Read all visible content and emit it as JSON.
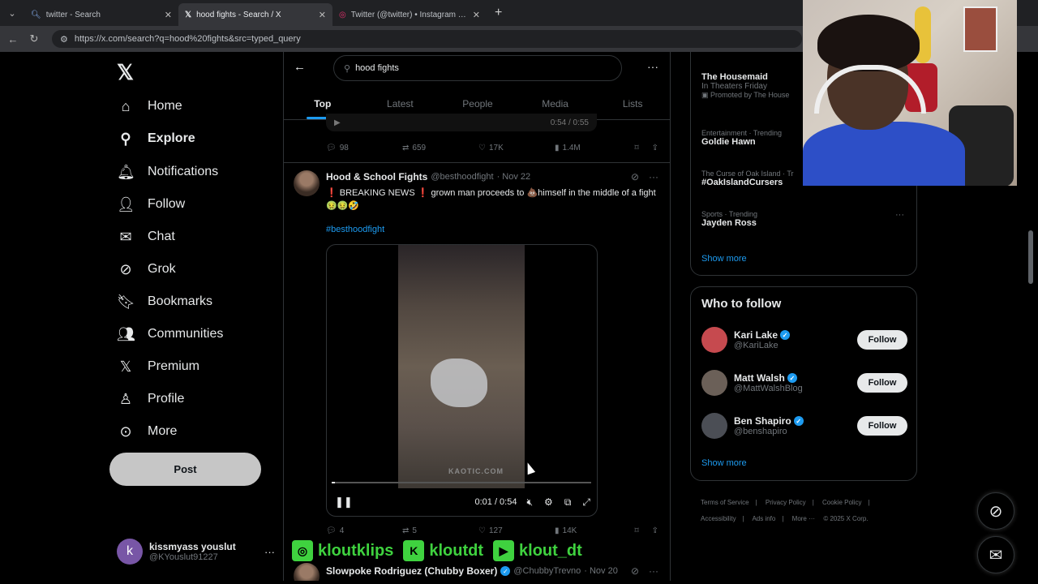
{
  "browser": {
    "tabs": [
      {
        "title": "twitter - Search",
        "icon": "search-icon"
      },
      {
        "title": "hood fights - Search / X",
        "icon": "x-logo-icon"
      },
      {
        "title": "Twitter (@twitter) • Instagram phot",
        "icon": "instagram-icon"
      }
    ],
    "url": "https://x.com/search?q=hood%20fights&src=typed_query"
  },
  "nav": {
    "items": [
      {
        "label": "Home",
        "icon": "home-icon"
      },
      {
        "label": "Explore",
        "icon": "search-icon"
      },
      {
        "label": "Notifications",
        "icon": "bell-icon"
      },
      {
        "label": "Follow",
        "icon": "follow-icon"
      },
      {
        "label": "Chat",
        "icon": "mail-icon"
      },
      {
        "label": "Grok",
        "icon": "grok-icon"
      },
      {
        "label": "Bookmarks",
        "icon": "bookmark-icon"
      },
      {
        "label": "Communities",
        "icon": "communities-icon"
      },
      {
        "label": "Premium",
        "icon": "x-logo-icon"
      },
      {
        "label": "Profile",
        "icon": "profile-icon"
      },
      {
        "label": "More",
        "icon": "more-icon"
      }
    ],
    "post_label": "Post"
  },
  "account": {
    "initial": "k",
    "name": "kissmyass youslut",
    "handle": "@KYouslut91227"
  },
  "search": {
    "query": "hood fights",
    "tabs": [
      "Top",
      "Latest",
      "People",
      "Media",
      "Lists"
    ]
  },
  "prev_tweet": {
    "video_time": "0:54 / 0:55",
    "replies": "98",
    "reposts": "659",
    "likes": "17K",
    "views": "1.4M"
  },
  "tweet": {
    "name": "Hood & School Fights",
    "handle": "@besthoodfight",
    "date": "· Nov 22",
    "text": "❗ BREAKING NEWS ❗ grown man proceeds to 💩himself in the middle of a fight🤢🤢🤣",
    "hashtag": "#besthoodfight",
    "video_time": "0:01 / 0:54",
    "watermark": "KAOTIC.COM",
    "replies": "4",
    "reposts": "5",
    "likes": "127",
    "views": "14K"
  },
  "next_tweet": {
    "name": "Slowpoke Rodriguez (Chubby Boxer)",
    "handle": "@ChubbyTrevno",
    "date": "· Nov 20"
  },
  "overlay": [
    {
      "label": "kloutklips",
      "icon": "instagram-icon"
    },
    {
      "label": "kloutdt",
      "icon": "kick-icon"
    },
    {
      "label": "klout_dt",
      "icon": "youtube-icon"
    }
  ],
  "trends": [
    {
      "meta": "",
      "title": "The Housemaid",
      "sub": "In Theaters Friday",
      "promo": "Promoted by The House"
    },
    {
      "meta": "Entertainment · Trending",
      "title": "Goldie Hawn"
    },
    {
      "meta": "The Curse of Oak Island · Tr",
      "title": "#OakIslandCursers"
    },
    {
      "meta": "Sports · Trending",
      "title": "Jayden Ross"
    }
  ],
  "trends_show_more": "Show more",
  "who_to_follow": {
    "title": "Who to follow",
    "people": [
      {
        "name": "Kari Lake",
        "handle": "@KariLake",
        "avatar_color": "#c64a4f"
      },
      {
        "name": "Matt Walsh",
        "handle": "@MattWalshBlog",
        "avatar_color": "#6b6058"
      },
      {
        "name": "Ben Shapiro",
        "handle": "@benshapiro",
        "avatar_color": "#4b4e55"
      }
    ],
    "follow_label": "Follow",
    "show_more": "Show more"
  },
  "footer": {
    "links": [
      "Terms of Service",
      "|",
      "Privacy Policy",
      "|",
      "Cookie Policy",
      "|",
      "Accessibility",
      "|",
      "Ads info",
      "|",
      "More ···",
      "© 2025 X Corp."
    ]
  },
  "colors": {
    "accent": "#1d9bf0",
    "overlay_green": "#3fd23f",
    "background": "#000000"
  }
}
